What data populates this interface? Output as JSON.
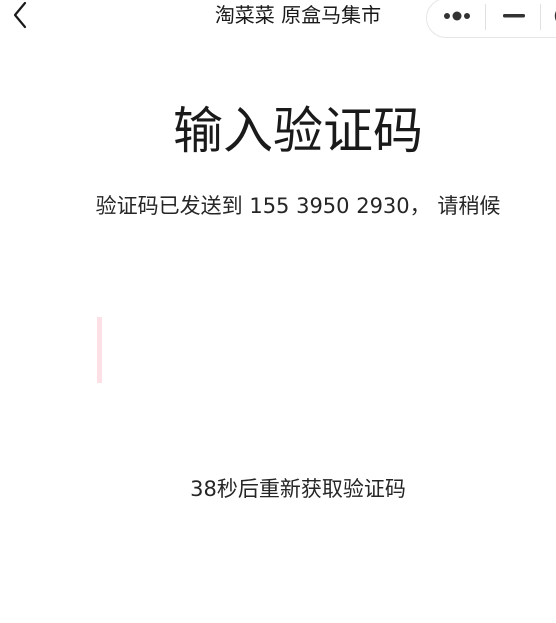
{
  "navbar": {
    "back_icon": "chevron-left-icon",
    "title": "淘菜菜 原盒马集市",
    "capsule": {
      "more_icon": "more-dots-icon",
      "minimize_icon": "minimize-icon",
      "close_icon": "close-circle-icon"
    }
  },
  "main": {
    "heading": "输入验证码",
    "subtitle": "验证码已发送到 155 3950 2930， 请稍候",
    "code_input_value": "",
    "resend_text": "38秒后重新获取验证码"
  },
  "colors": {
    "background": "#ffffff",
    "text": "#1a1a1a",
    "caret": "#fde0e6",
    "capsule_border": "#e6e6e6"
  }
}
